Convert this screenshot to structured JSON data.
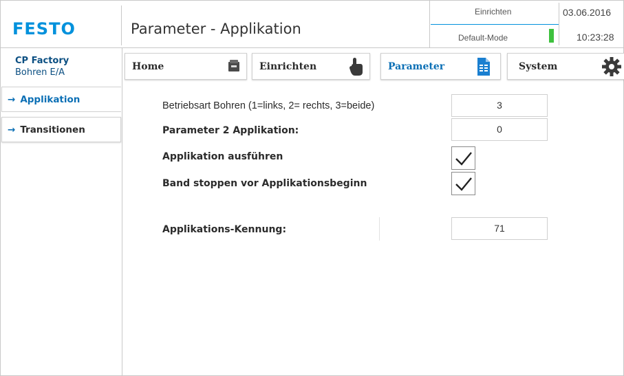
{
  "header": {
    "logo": "FESTO",
    "title": "Parameter - Applikation",
    "mode_top": "Einrichten",
    "mode_bottom": "Default-Mode",
    "date": "03.06.2016",
    "time": "10:23:28",
    "status_color": "#3ec13e"
  },
  "station": {
    "line1": "CP Factory",
    "line2": "Bohren E/A"
  },
  "nav": {
    "home": {
      "label": "Home",
      "icon": "home-icon"
    },
    "einrichten": {
      "label": "Einrichten",
      "icon": "hand-pointer-icon"
    },
    "parameter": {
      "label": "Parameter",
      "icon": "document-icon",
      "active": true
    },
    "system": {
      "label": "System",
      "icon": "gear-icon"
    }
  },
  "sidebar": {
    "items": [
      {
        "label": "Applikation",
        "active": true
      },
      {
        "label": "Transitionen",
        "active": false
      }
    ]
  },
  "form": {
    "betriebsart": {
      "label": "Betriebsart Bohren (1=links, 2= rechts, 3=beide)",
      "value": "3"
    },
    "param2": {
      "label": "Parameter 2 Applikation:",
      "value": "0"
    },
    "ausfuehren": {
      "label": "Applikation ausführen",
      "checked": true
    },
    "band_stoppen": {
      "label": "Band stoppen vor Applikationsbeginn",
      "checked": true
    },
    "kennung": {
      "label": "Applikations-Kennung:",
      "value": "71"
    }
  },
  "colors": {
    "accent": "#0091dc",
    "active_text": "#0b6fb5",
    "station_text": "#0b4f82"
  }
}
